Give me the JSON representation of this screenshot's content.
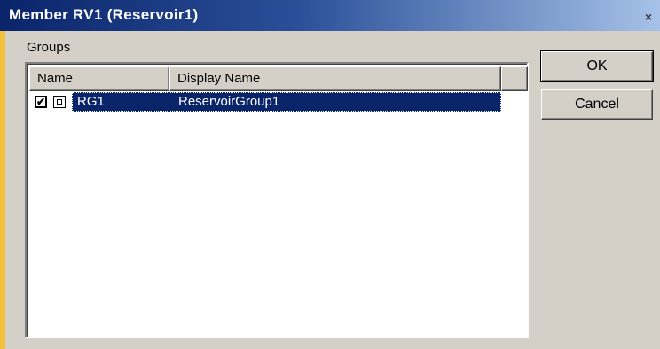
{
  "window": {
    "title": "Member RV1 (Reservoir1)",
    "close_glyph": "×"
  },
  "groups": {
    "label": "Groups",
    "columns": [
      "Name",
      "Display Name"
    ],
    "rows": [
      {
        "checked": true,
        "check_glyph": "✔",
        "icon": "group-item-icon",
        "name": "RG1",
        "display_name": "ReservoirGroup1",
        "selected": true
      }
    ]
  },
  "buttons": {
    "ok_label": "OK",
    "cancel_label": "Cancel"
  },
  "colors": {
    "titlebar_start": "#0a246a",
    "titlebar_end": "#a6c2e8",
    "selection": "#0a246a",
    "dialog_face": "#d4d0c8"
  }
}
